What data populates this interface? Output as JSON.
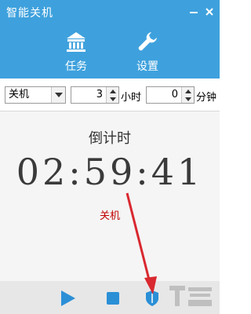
{
  "window": {
    "title": "智能关机"
  },
  "nav": [
    {
      "label": "任务",
      "icon": "bank-icon"
    },
    {
      "label": "设置",
      "icon": "wrench-icon"
    }
  ],
  "controls": {
    "action_select": "关机",
    "hours_value": "3",
    "hours_unit": "小时",
    "minutes_value": "0",
    "minutes_unit": "分钟"
  },
  "countdown": {
    "title": "倒计时",
    "time": "02:59:41",
    "action": "关机"
  },
  "footer": {
    "buttons": [
      "play-icon",
      "stop-icon",
      "shield-icon"
    ]
  },
  "colors": {
    "header": "#3ea1dd",
    "action_text": "#c00000",
    "arrow": "#d9282f"
  }
}
